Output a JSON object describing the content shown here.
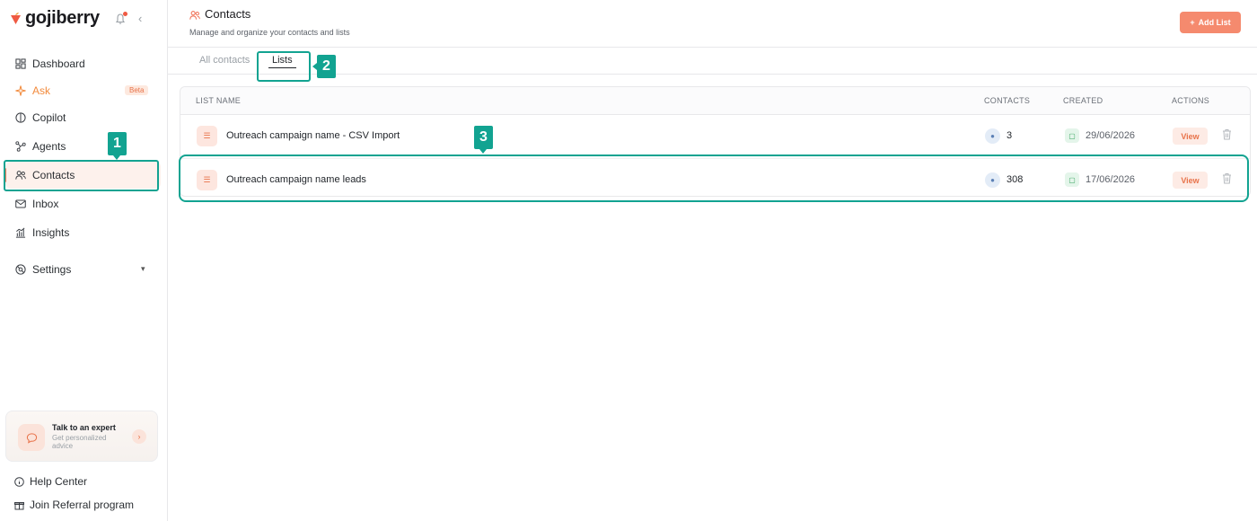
{
  "brand": {
    "name": "gojiberry"
  },
  "sidebar": {
    "items": [
      {
        "label": "Dashboard",
        "icon": "grid-icon"
      },
      {
        "label": "Ask",
        "icon": "sparkle-icon",
        "badge": "Beta"
      },
      {
        "label": "Copilot",
        "icon": "copilot-icon"
      },
      {
        "label": "Agents",
        "icon": "agents-icon"
      },
      {
        "label": "Contacts",
        "icon": "users-icon",
        "active": true
      },
      {
        "label": "Inbox",
        "icon": "mail-icon"
      },
      {
        "label": "Insights",
        "icon": "chart-icon"
      },
      {
        "label": "Settings",
        "icon": "settings-icon"
      }
    ],
    "expert": {
      "title": "Talk to an expert",
      "subtitle": "Get personalized advice"
    },
    "footer": {
      "help": "Help Center",
      "referral": "Join Referral program"
    }
  },
  "header": {
    "title": "Contacts",
    "subtitle": "Manage and organize your contacts and lists",
    "add_button": "Add List"
  },
  "tabs": [
    {
      "label": "All contacts",
      "active": false
    },
    {
      "label": "Lists",
      "active": true
    }
  ],
  "table": {
    "columns": [
      "LIST NAME",
      "CONTACTS",
      "CREATED",
      "ACTIONS"
    ],
    "rows": [
      {
        "name": "Outreach campaign name - CSV Import",
        "contacts": "3",
        "created": "29/06/2026",
        "action": "View"
      },
      {
        "name": "Outreach campaign name leads",
        "contacts": "308",
        "created": "17/06/2026",
        "action": "View"
      }
    ]
  },
  "annotations": {
    "one": "1",
    "two": "2",
    "three": "3"
  },
  "colors": {
    "accent": "#f58a6e",
    "annotation": "#12a391"
  }
}
